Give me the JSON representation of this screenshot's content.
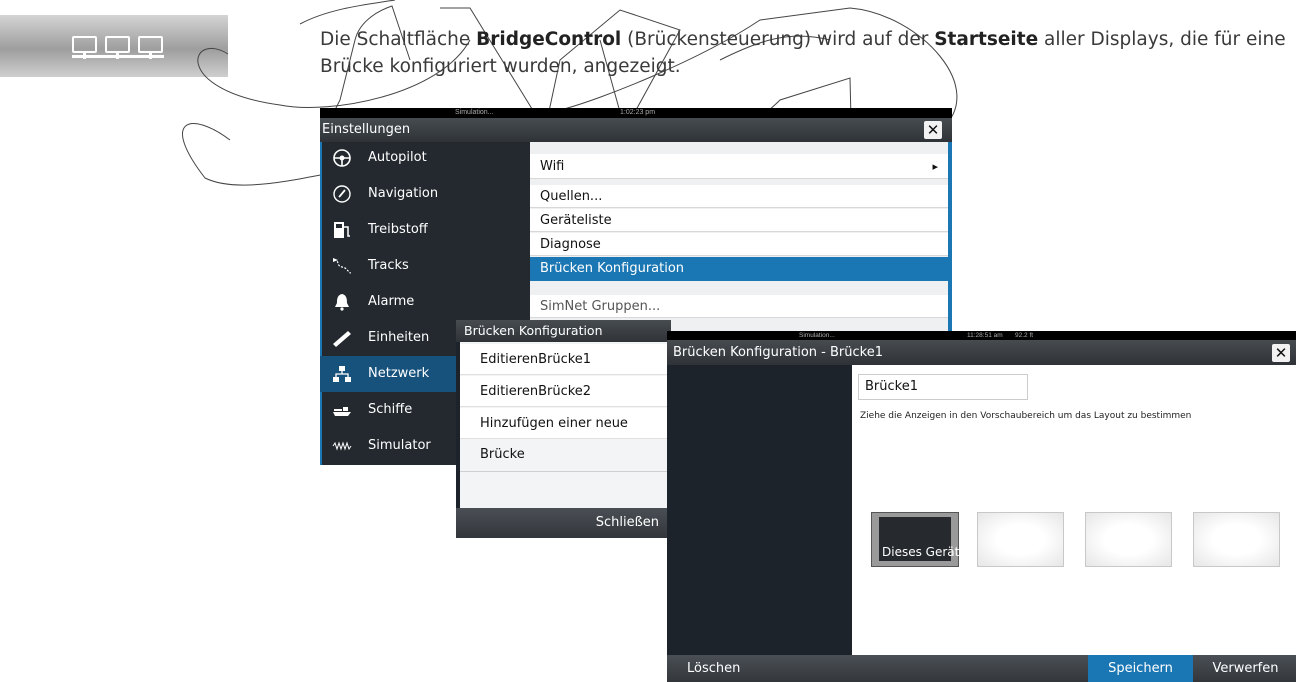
{
  "caption": {
    "part1": "Die Schaltfläche ",
    "bold1": "BridgeControl",
    "part2": " (Brückensteuerung) wird auf der ",
    "bold2": "Startseite",
    "part3": " aller Displays, die für eine Brücke konfiguriert wurden, angezeigt."
  },
  "settings": {
    "status_left": "Simulation...",
    "status_time": "1:02:23 pm",
    "title": "Einstellungen",
    "close_glyph": "✕",
    "sidebar": [
      {
        "label": "Autopilot",
        "icon": "steering-wheel-icon"
      },
      {
        "label": "Navigation",
        "icon": "compass-icon"
      },
      {
        "label": "Treibstoff",
        "icon": "fuel-pump-icon"
      },
      {
        "label": "Tracks",
        "icon": "tracks-icon"
      },
      {
        "label": "Alarme",
        "icon": "bell-icon"
      },
      {
        "label": "Einheiten",
        "icon": "ruler-icon"
      },
      {
        "label": "Netzwerk",
        "icon": "network-icon"
      },
      {
        "label": "Schiffe",
        "icon": "ship-icon"
      },
      {
        "label": "Simulator",
        "icon": "simulator-wave-icon"
      }
    ],
    "menu": [
      {
        "label": "Wifi",
        "arrow": "▸"
      },
      {
        "label": "Quellen..."
      },
      {
        "label": "Geräteliste"
      },
      {
        "label": "Diagnose"
      },
      {
        "label": "Brücken Konfiguration"
      },
      {
        "label": "SimNet Gruppen..."
      }
    ],
    "colors": {
      "accent": "#1b77b3",
      "sidebar_selected": "#17527d"
    }
  },
  "bk_dialog": {
    "title": "Brücken Konfiguration",
    "items": [
      "EditierenBrücke1",
      "EditierenBrücke2",
      "Hinzufügen einer neue Brücke"
    ],
    "close_label": "Schließen"
  },
  "bk_main": {
    "status_left": "Simulation...",
    "status_time": "11:28:51 am",
    "status_extra": "92.2 ft",
    "title": "Brücken Konfiguration - Brücke1",
    "close_glyph": "✕",
    "name_value": "Brücke1",
    "instruction": "Ziehe die Anzeigen in den Vorschaubereich um das Layout zu bestimmen",
    "device_label": "Dieses Gerät",
    "delete_label": "Löschen",
    "save_label": "Speichern",
    "discard_label": "Verwerfen"
  }
}
